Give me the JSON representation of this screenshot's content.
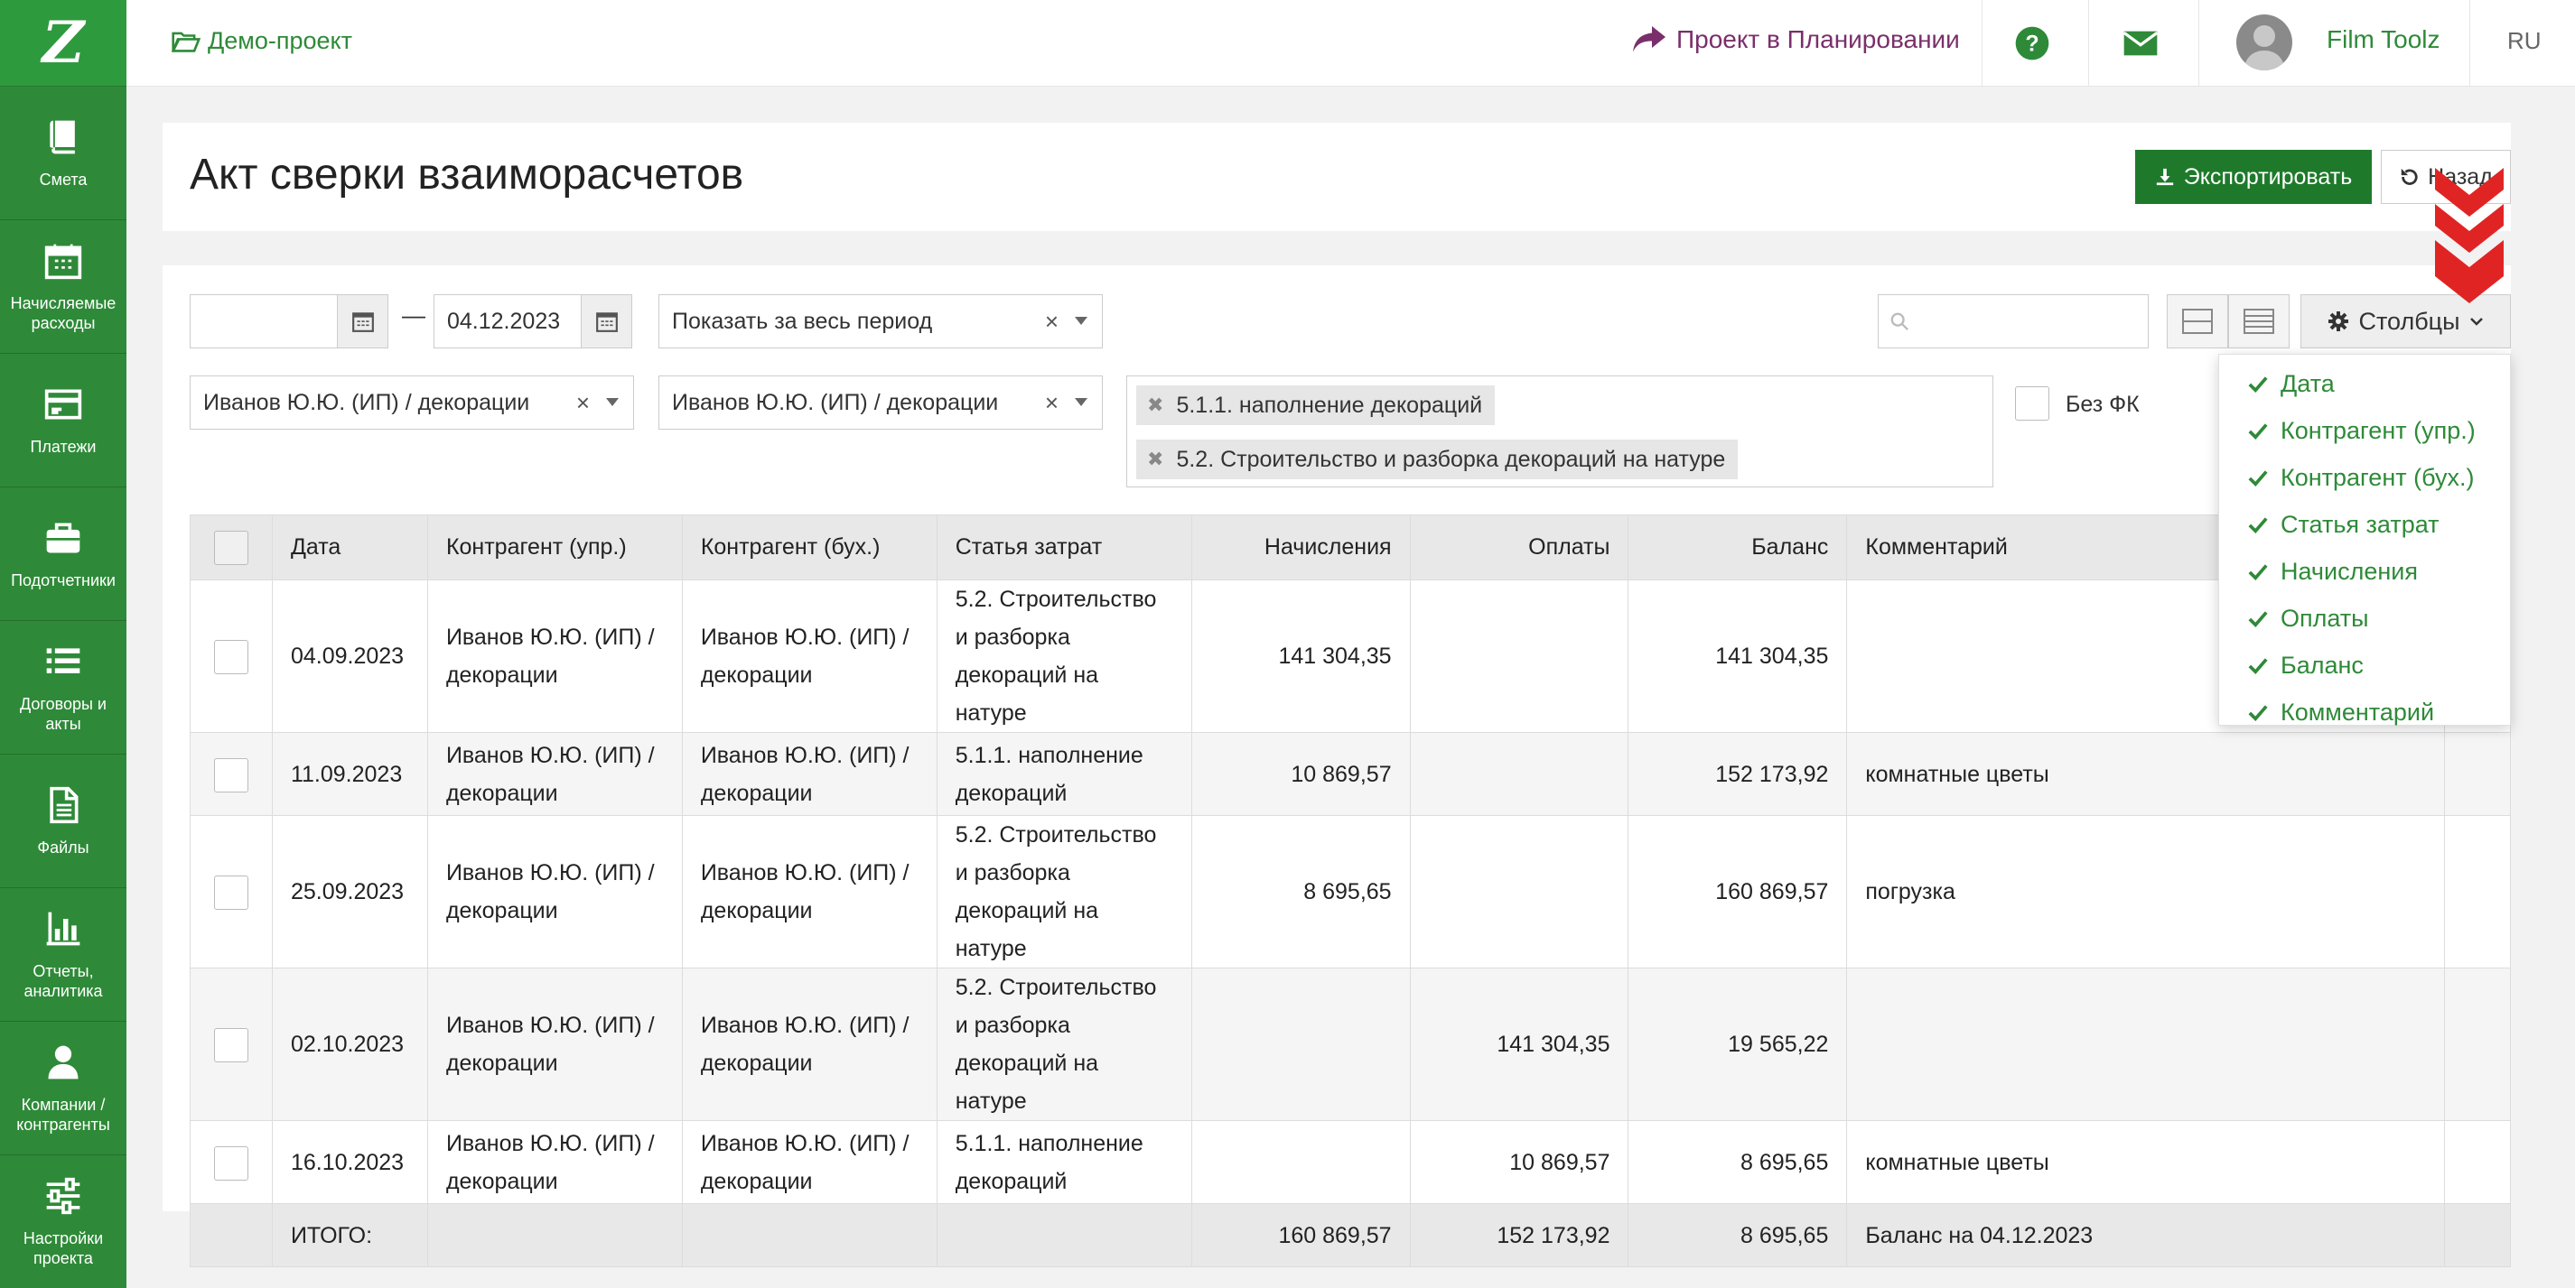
{
  "sidebar": {
    "logo": "Z",
    "items": [
      {
        "label": "Смета",
        "icon": "book-icon"
      },
      {
        "label": "Начисляемые расходы",
        "icon": "calendar-icon"
      },
      {
        "label": "Платежи",
        "icon": "card-icon"
      },
      {
        "label": "Подотчетники",
        "icon": "briefcase-icon"
      },
      {
        "label": "Договоры и акты",
        "icon": "list-icon"
      },
      {
        "label": "Файлы",
        "icon": "file-icon"
      },
      {
        "label": "Отчеты, аналитика",
        "icon": "bar-chart-icon"
      },
      {
        "label": "Компании / контрагенты",
        "icon": "user-icon"
      },
      {
        "label": "Настройки проекта",
        "icon": "sliders-icon"
      }
    ]
  },
  "topbar": {
    "project": "Демо-проект",
    "planning": "Проект в Планировании",
    "user": "Film Toolz",
    "lang": "RU"
  },
  "page": {
    "title": "Акт сверки взаиморасчетов",
    "export_label": "Экспортировать",
    "back_label": "Назад"
  },
  "filters": {
    "date_from": "",
    "date_to": "04.12.2023",
    "period": "Показать за весь период",
    "counterparty_mgmt": "Иванов Ю.Ю. (ИП) / декорации",
    "counterparty_acc": "Иванов Ю.Ю. (ИП) / декорации",
    "tags": [
      "5.1.1. наполнение декораций",
      "5.2. Строительство и разборка декораций на натуре"
    ],
    "no_fk_label": "Без ФК",
    "search_placeholder": "",
    "columns_label": "Столбцы"
  },
  "table": {
    "headers": [
      "Дата",
      "Контрагент (упр.)",
      "Контрагент (бух.)",
      "Статья затрат",
      "Начисления",
      "Оплаты",
      "Баланс",
      "Комментарий"
    ],
    "rows": [
      {
        "date": "04.09.2023",
        "cp_mgmt": "Иванов Ю.Ю. (ИП) / декорации",
        "cp_acc": "Иванов Ю.Ю. (ИП) / декорации",
        "article": "5.2. Строительство и разборка декораций на натуре",
        "accrual": "141 304,35",
        "payment": "",
        "balance": "141 304,35",
        "comment": ""
      },
      {
        "date": "11.09.2023",
        "cp_mgmt": "Иванов Ю.Ю. (ИП) / декорации",
        "cp_acc": "Иванов Ю.Ю. (ИП) / декорации",
        "article": "5.1.1. наполнение декораций",
        "accrual": "10 869,57",
        "payment": "",
        "balance": "152 173,92",
        "comment": "комнатные цветы"
      },
      {
        "date": "25.09.2023",
        "cp_mgmt": "Иванов Ю.Ю. (ИП) / декорации",
        "cp_acc": "Иванов Ю.Ю. (ИП) / декорации",
        "article": "5.2. Строительство и разборка декораций на натуре",
        "accrual": "8 695,65",
        "payment": "",
        "balance": "160 869,57",
        "comment": "погрузка"
      },
      {
        "date": "02.10.2023",
        "cp_mgmt": "Иванов Ю.Ю. (ИП) / декорации",
        "cp_acc": "Иванов Ю.Ю. (ИП) / декорации",
        "article": "5.2. Строительство и разборка декораций на натуре",
        "accrual": "",
        "payment": "141 304,35",
        "balance": "19 565,22",
        "comment": ""
      },
      {
        "date": "16.10.2023",
        "cp_mgmt": "Иванов Ю.Ю. (ИП) / декорации",
        "cp_acc": "Иванов Ю.Ю. (ИП) / декорации",
        "article": "5.1.1. наполнение декораций",
        "accrual": "",
        "payment": "10 869,57",
        "balance": "8 695,65",
        "comment": "комнатные цветы"
      }
    ],
    "total": {
      "label": "ИТОГО:",
      "accrual": "160 869,57",
      "payment": "152 173,92",
      "balance": "8 695,65",
      "comment": "Баланс на 04.12.2023"
    }
  },
  "columns_menu": [
    "Дата",
    "Контрагент (упр.)",
    "Контрагент (бух.)",
    "Статья затрат",
    "Начисления",
    "Оплаты",
    "Баланс",
    "Комментарий"
  ],
  "colors": {
    "brand": "#2e8a38",
    "export": "#1e7a2a",
    "accent_arrow": "#e02424",
    "planning": "#7a2f6a"
  }
}
